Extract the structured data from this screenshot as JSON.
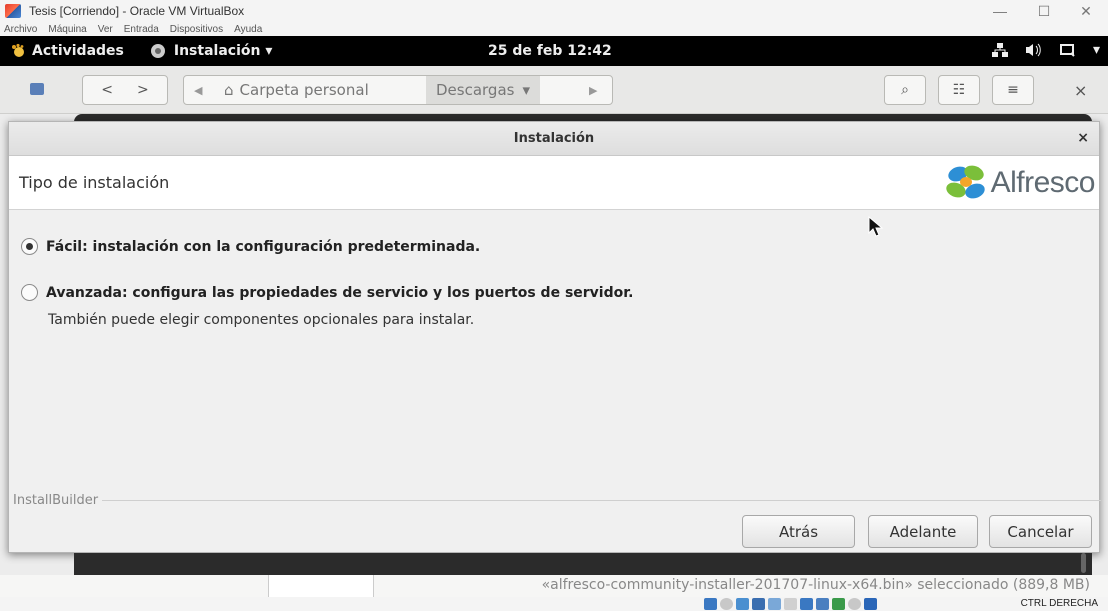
{
  "vbox": {
    "title": "Tesis [Corriendo] - Oracle VM VirtualBox",
    "menu": [
      "Archivo",
      "Máquina",
      "Ver",
      "Entrada",
      "Dispositivos",
      "Ayuda"
    ],
    "host_key": "CTRL DERECHA"
  },
  "gnome": {
    "activities": "Actividades",
    "app_menu": "Instalación ▾",
    "clock": "25 de feb 12:42"
  },
  "nautilus": {
    "crumb_home": "Carpeta personal",
    "crumb_current": "Descargas",
    "status": "«alfresco-community-installer-201707-linux-x64.bin» seleccionado (889,8 MB)"
  },
  "dialog": {
    "title": "Instalación",
    "close": "×",
    "header": "Tipo de instalación",
    "logo_text": "Alfresco",
    "options": [
      {
        "label": "Fácil: instalación con la configuración predeterminada.",
        "selected": true
      },
      {
        "label": "Avanzada: configura las propiedades de servicio y los puertos de servidor.",
        "selected": false
      }
    ],
    "advanced_note": "También puede elegir componentes opcionales para instalar.",
    "footer_brand": "InstallBuilder",
    "buttons": {
      "back": "Atrás",
      "next": "Adelante",
      "cancel": "Cancelar"
    }
  },
  "colors": {
    "gnome_bar": "#000000",
    "dialog_bg": "#f0f0f0",
    "alfresco_green": "#7bbf3a",
    "alfresco_blue": "#2d8fd5"
  }
}
